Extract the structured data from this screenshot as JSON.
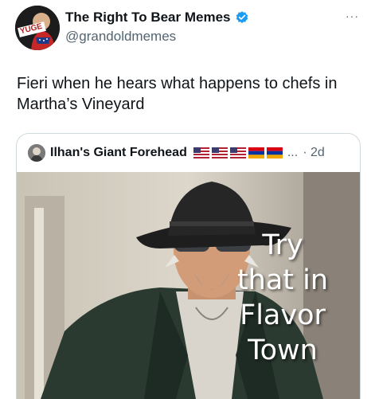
{
  "author": {
    "display_name": "The Right To Bear Memes",
    "handle": "@grandoldmemes",
    "verified_color": "#1d9bf0",
    "avatar_text": "YUGE"
  },
  "more_glyph": "···",
  "tweet_text": "Fieri when he hears what happens to chefs in Martha’s Vineyard",
  "quote": {
    "display_name": "Ilhan's Giant Forehead",
    "flags": [
      "us-flag-icon",
      "us-flag-icon",
      "us-flag-icon",
      "armenia-flag-icon",
      "armenia-flag-icon"
    ],
    "ellipsis": "...",
    "time": "· 2d"
  },
  "meme": {
    "caption_lines": [
      "Try",
      "that in",
      "Flavor",
      "Town"
    ]
  }
}
